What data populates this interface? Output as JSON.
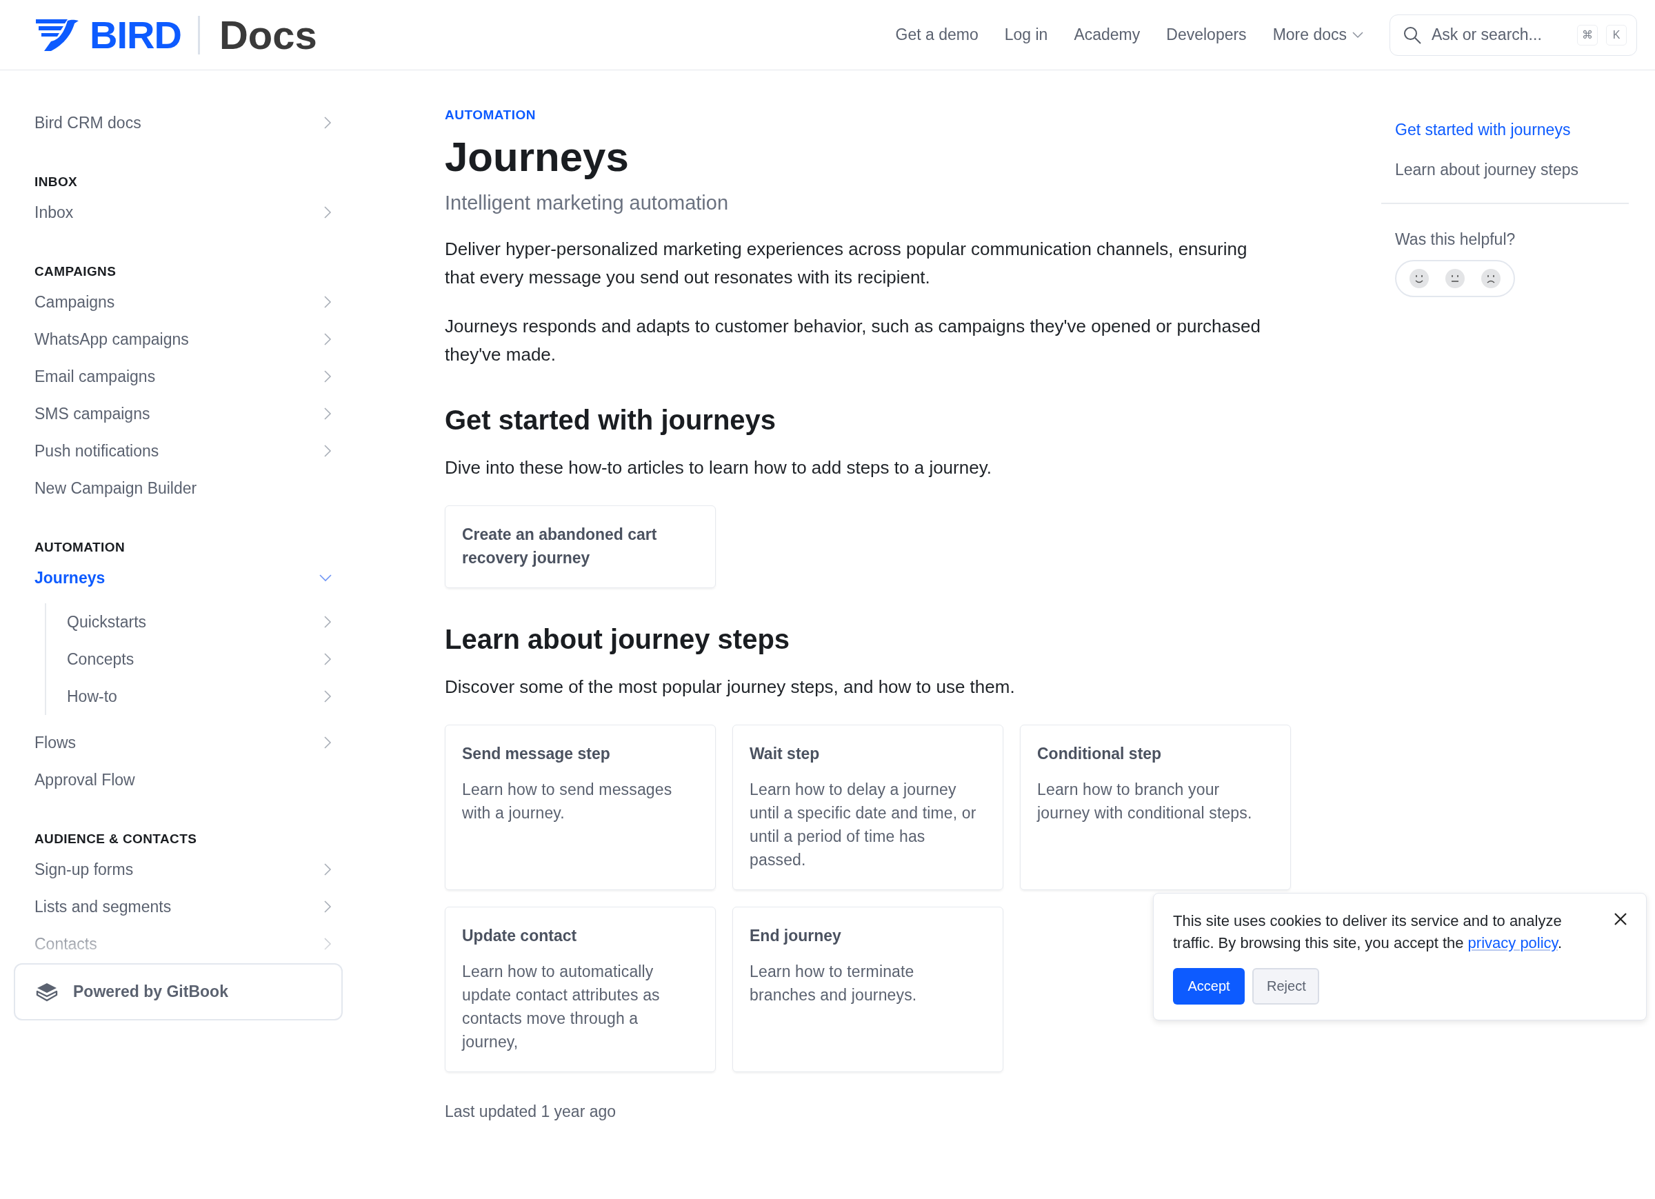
{
  "header": {
    "logo": "BIRD",
    "product": "Docs",
    "nav": [
      {
        "label": "Get a demo",
        "kind": "link"
      },
      {
        "label": "Log in",
        "kind": "link"
      },
      {
        "label": "Academy",
        "kind": "link"
      },
      {
        "label": "Developers",
        "kind": "link"
      },
      {
        "label": "More docs",
        "kind": "dropdown"
      }
    ],
    "search": {
      "placeholder": "Ask or search...",
      "keys": [
        "⌘",
        "K"
      ]
    }
  },
  "sidebar": {
    "sections": [
      {
        "items": [
          {
            "label": "Bird CRM docs",
            "kind": "expandable",
            "selected": false,
            "expanded": false
          }
        ]
      },
      {
        "heading": "INBOX",
        "items": [
          {
            "label": "Inbox",
            "kind": "expandable",
            "selected": false,
            "expanded": false
          }
        ]
      },
      {
        "heading": "CAMPAIGNS",
        "items": [
          {
            "label": "Campaigns",
            "kind": "expandable",
            "selected": false,
            "expanded": false
          },
          {
            "label": "WhatsApp campaigns",
            "kind": "expandable",
            "selected": false,
            "expanded": false
          },
          {
            "label": "Email campaigns",
            "kind": "expandable",
            "selected": false,
            "expanded": false
          },
          {
            "label": "SMS campaigns",
            "kind": "expandable",
            "selected": false,
            "expanded": false
          },
          {
            "label": "Push notifications",
            "kind": "expandable",
            "selected": false,
            "expanded": false
          },
          {
            "label": "New Campaign Builder",
            "kind": "page",
            "selected": false
          }
        ]
      },
      {
        "heading": "AUTOMATION",
        "items": [
          {
            "label": "Journeys",
            "kind": "expandable",
            "selected": true,
            "expanded": true,
            "children": [
              {
                "label": "Quickstarts",
                "kind": "expandable",
                "selected": false,
                "expanded": false
              },
              {
                "label": "Concepts",
                "kind": "expandable",
                "selected": false,
                "expanded": false
              },
              {
                "label": "How-to",
                "kind": "expandable",
                "selected": false,
                "expanded": false
              }
            ]
          },
          {
            "label": "Flows",
            "kind": "expandable",
            "selected": false,
            "expanded": false
          },
          {
            "label": "Approval Flow",
            "kind": "page",
            "selected": false
          }
        ]
      },
      {
        "heading": "AUDIENCE & CONTACTS",
        "items": [
          {
            "label": "Sign-up forms",
            "kind": "expandable",
            "selected": false,
            "expanded": false
          },
          {
            "label": "Lists and segments",
            "kind": "expandable",
            "selected": false,
            "expanded": false
          },
          {
            "label": "Contacts",
            "kind": "expandable",
            "selected": false,
            "expanded": false
          }
        ]
      }
    ],
    "footer": "Powered by GitBook"
  },
  "article": {
    "breadcrumb": "AUTOMATION",
    "title": "Journeys",
    "subtitle": "Intelligent marketing automation",
    "paragraphs": [
      "Deliver hyper-personalized marketing experiences across popular communication channels, ensuring that every message you send out resonates with its recipient.",
      "Journeys responds and adapts to customer behavior, such as campaigns they've opened or purchased they've made."
    ],
    "sections": [
      {
        "heading": "Get started with journeys",
        "intro": "Dive into these how-to articles to learn how to add steps to a journey.",
        "cards": [
          {
            "title": "Create an abandoned cart recovery journey"
          }
        ]
      },
      {
        "heading": "Learn about journey steps",
        "intro": "Discover some of the most popular journey steps, and how to use them.",
        "cards": [
          {
            "title": "Send message step",
            "description": "Learn how to send messages with a journey."
          },
          {
            "title": "Wait step",
            "description": "Learn how to delay a journey until a specific date and time, or until a period of time has passed."
          },
          {
            "title": "Conditional step",
            "description": "Learn how to branch your journey with conditional steps."
          },
          {
            "title": "Update contact",
            "description": "Learn how to automatically update contact attributes as contacts move through a journey,"
          },
          {
            "title": "End journey",
            "description": "Learn how to terminate branches and journeys."
          }
        ]
      }
    ],
    "last_updated": "Last updated 1 year ago"
  },
  "toc": {
    "items": [
      {
        "label": "Get started with journeys",
        "selected": true
      },
      {
        "label": "Learn about journey steps",
        "selected": false
      }
    ],
    "feedback": {
      "label": "Was this helpful?"
    }
  },
  "cookie_banner": {
    "text": "This site uses cookies to deliver its service and to analyze traffic. By browsing this site, you accept the ",
    "link": "privacy policy",
    "text_after": ".",
    "buttons": [
      {
        "label": "Accept",
        "kind": "primary"
      },
      {
        "label": "Reject",
        "kind": "secondary"
      }
    ]
  }
}
